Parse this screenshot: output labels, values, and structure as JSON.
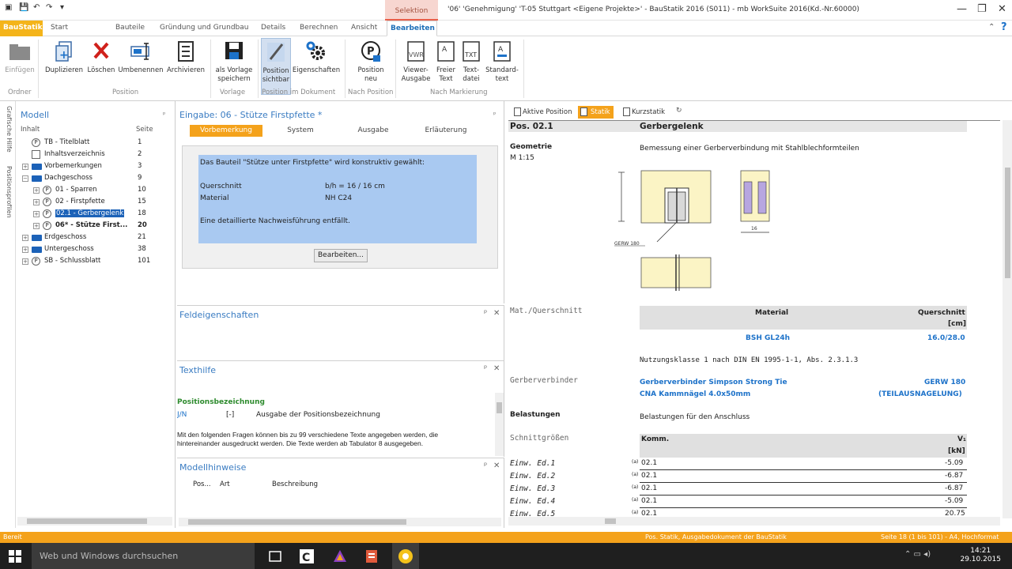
{
  "window": {
    "title": "'06' 'Genehmigung' 'T-05 Stuttgart <Eigene Projekte>' - BauStatik 2016 (S011) - mb WorkSuite 2016(Kd.-Nr.60000)",
    "context_tab": "Selektion"
  },
  "tabs": [
    "BauStatik",
    "Start",
    "Bauteile",
    "Gründung und Grundbau",
    "Details",
    "Berechnen",
    "Ansicht",
    "Bearbeiten"
  ],
  "ribbon": {
    "buttons": {
      "einfuegen": "Einfügen",
      "duplizieren": "Duplizieren",
      "loeschen": "Löschen",
      "umbenennen": "Umbenennen",
      "archivieren": "Archivieren",
      "vorlage1": "als Vorlage",
      "vorlage2": "speichern",
      "possicht1": "Position",
      "possicht2": "sichtbar",
      "eigenschaften": "Eigenschaften",
      "posneu1": "Position",
      "posneu2": "neu",
      "viewer1": "Viewer-",
      "viewer2": "Ausgabe",
      "freier1": "Freier",
      "freier2": "Text",
      "textdatei1": "Text-",
      "textdatei2": "datei",
      "standard1": "Standard-",
      "standard2": "text"
    },
    "groups": {
      "ordner": "Ordner",
      "position": "Position",
      "vorlage": "Vorlage",
      "posdok": "Position im Dokument",
      "nachpos": "Nach Position",
      "nachmark": "Nach Markierung"
    }
  },
  "side_strip": [
    "Grafische Hilfe",
    "Positionsprofilen"
  ],
  "model": {
    "title": "Modell",
    "col_inhalt": "Inhalt",
    "col_seite": "Seite",
    "rows": [
      {
        "icon": "P",
        "label": "TB - Titelblatt",
        "page": "1"
      },
      {
        "icon": "doc",
        "label": "Inhaltsverzeichnis",
        "page": "2"
      },
      {
        "icon": "folder",
        "label": "Vorbemerkungen",
        "page": "3"
      },
      {
        "icon": "folder",
        "label": "Dachgeschoss",
        "page": "9"
      },
      {
        "icon": "P",
        "label": "01 - Sparren",
        "page": "10"
      },
      {
        "icon": "P",
        "label": "02 - Firstpfette",
        "page": "15"
      },
      {
        "icon": "P",
        "label": "02.1 - Gerbergelenk",
        "page": "18"
      },
      {
        "icon": "P",
        "label": "06* - Stütze First...",
        "page": "20"
      },
      {
        "icon": "folder",
        "label": "Erdgeschoss",
        "page": "21"
      },
      {
        "icon": "folder",
        "label": "Untergeschoss",
        "page": "38"
      },
      {
        "icon": "P",
        "label": "SB - Schlussblatt",
        "page": "101"
      }
    ]
  },
  "input": {
    "title": "Eingabe: 06 - Stütze Firstpfette *",
    "subtabs": [
      "Vorbemerkung",
      "System",
      "Ausgabe",
      "Erläuterung"
    ],
    "text_line1": "Das Bauteil \"Stütze unter Firstpfette\" wird konstruktiv gewählt:",
    "row1_label": "Querschnitt",
    "row1_value": "b/h = 16 / 16 cm",
    "row2_label": "Material",
    "row2_value": "NH C24",
    "text_line2": "Eine detaillierte Nachweisführung entfällt.",
    "edit_button": "Bearbeiten..."
  },
  "feld": {
    "title": "Feldeigenschaften"
  },
  "texthilfe": {
    "title": "Texthilfe",
    "heading": "Positionsbezeichnung",
    "key": "J/N",
    "bracket": "[-]",
    "desc": "Ausgabe der Positionsbezeichnung",
    "para1": "Mit den folgenden Fragen können bis zu 99 verschiedene Texte angegeben werden, die",
    "para2": "hintereinander ausgedruckt werden. Die Texte werden ab Tabulator 8 ausgegeben."
  },
  "hinweise": {
    "title": "Modellhinweise",
    "cols": [
      "Pos...",
      "Art",
      "Beschreibung"
    ]
  },
  "doc_tabs": [
    "Aktive Position",
    "Statik",
    "Kurzstatik"
  ],
  "document": {
    "pos": "Pos. 02.1",
    "name": "Gerbergelenk",
    "geometrie": "Geometrie",
    "scale": "M 1:15",
    "desc": "Bemessung einer Gerberverbindung mit Stahlblechformteilen",
    "drawing_label": "GERW 180",
    "dim_label": "16",
    "mat_label": "Mat./Querschnitt",
    "mat_head_material": "Material",
    "mat_head_qs": "Querschnitt",
    "mat_head_unit": "[cm]",
    "mat_value": "BSH GL24h",
    "qs_value": "16.0/28.0",
    "nutzung": "Nutzungsklasse 1 nach DIN EN 1995-1-1, Abs. 2.3.1.3",
    "gv_label": "Gerberverbinder",
    "gv_value1": "Gerberverbinder Simpson Strong Tie",
    "gv_value2": "CNA Kammnägel 4.0x50mm",
    "gv_type1": "GERW 180",
    "gv_type2": "(TEILAUSNAGELUNG)",
    "belastungen": "Belastungen",
    "belast_desc": "Belastungen für den Anschluss",
    "schnitt": "Schnittgrößen",
    "komm_head": "Komm.",
    "v_head": "V₁",
    "v_unit": "[kN]",
    "loads": [
      {
        "label": "Einw. Ed.1",
        "komm": "02.1",
        "v": "-5.09"
      },
      {
        "label": "Einw. Ed.2",
        "komm": "02.1",
        "v": "-6.87"
      },
      {
        "label": "Einw. Ed.3",
        "komm": "02.1",
        "v": "-6.87"
      },
      {
        "label": "Einw. Ed.4",
        "komm": "02.1",
        "v": "-5.09"
      },
      {
        "label": "Einw. Ed.5",
        "komm": "02.1",
        "v": "20.75"
      }
    ]
  },
  "status": {
    "left": "Bereit",
    "mid": "Pos. Statik, Ausgabedokument der BauStatik",
    "right": "Seite 18 (1 bis 101) - A4, Hochformat"
  },
  "taskbar": {
    "search": "Web und Windows durchsuchen",
    "time": "14:21",
    "date": "29.10.2015"
  },
  "colors": {
    "accent": "#f4a21b",
    "brand_blue": "#1d72c9",
    "selection": "#a9c9f1"
  }
}
